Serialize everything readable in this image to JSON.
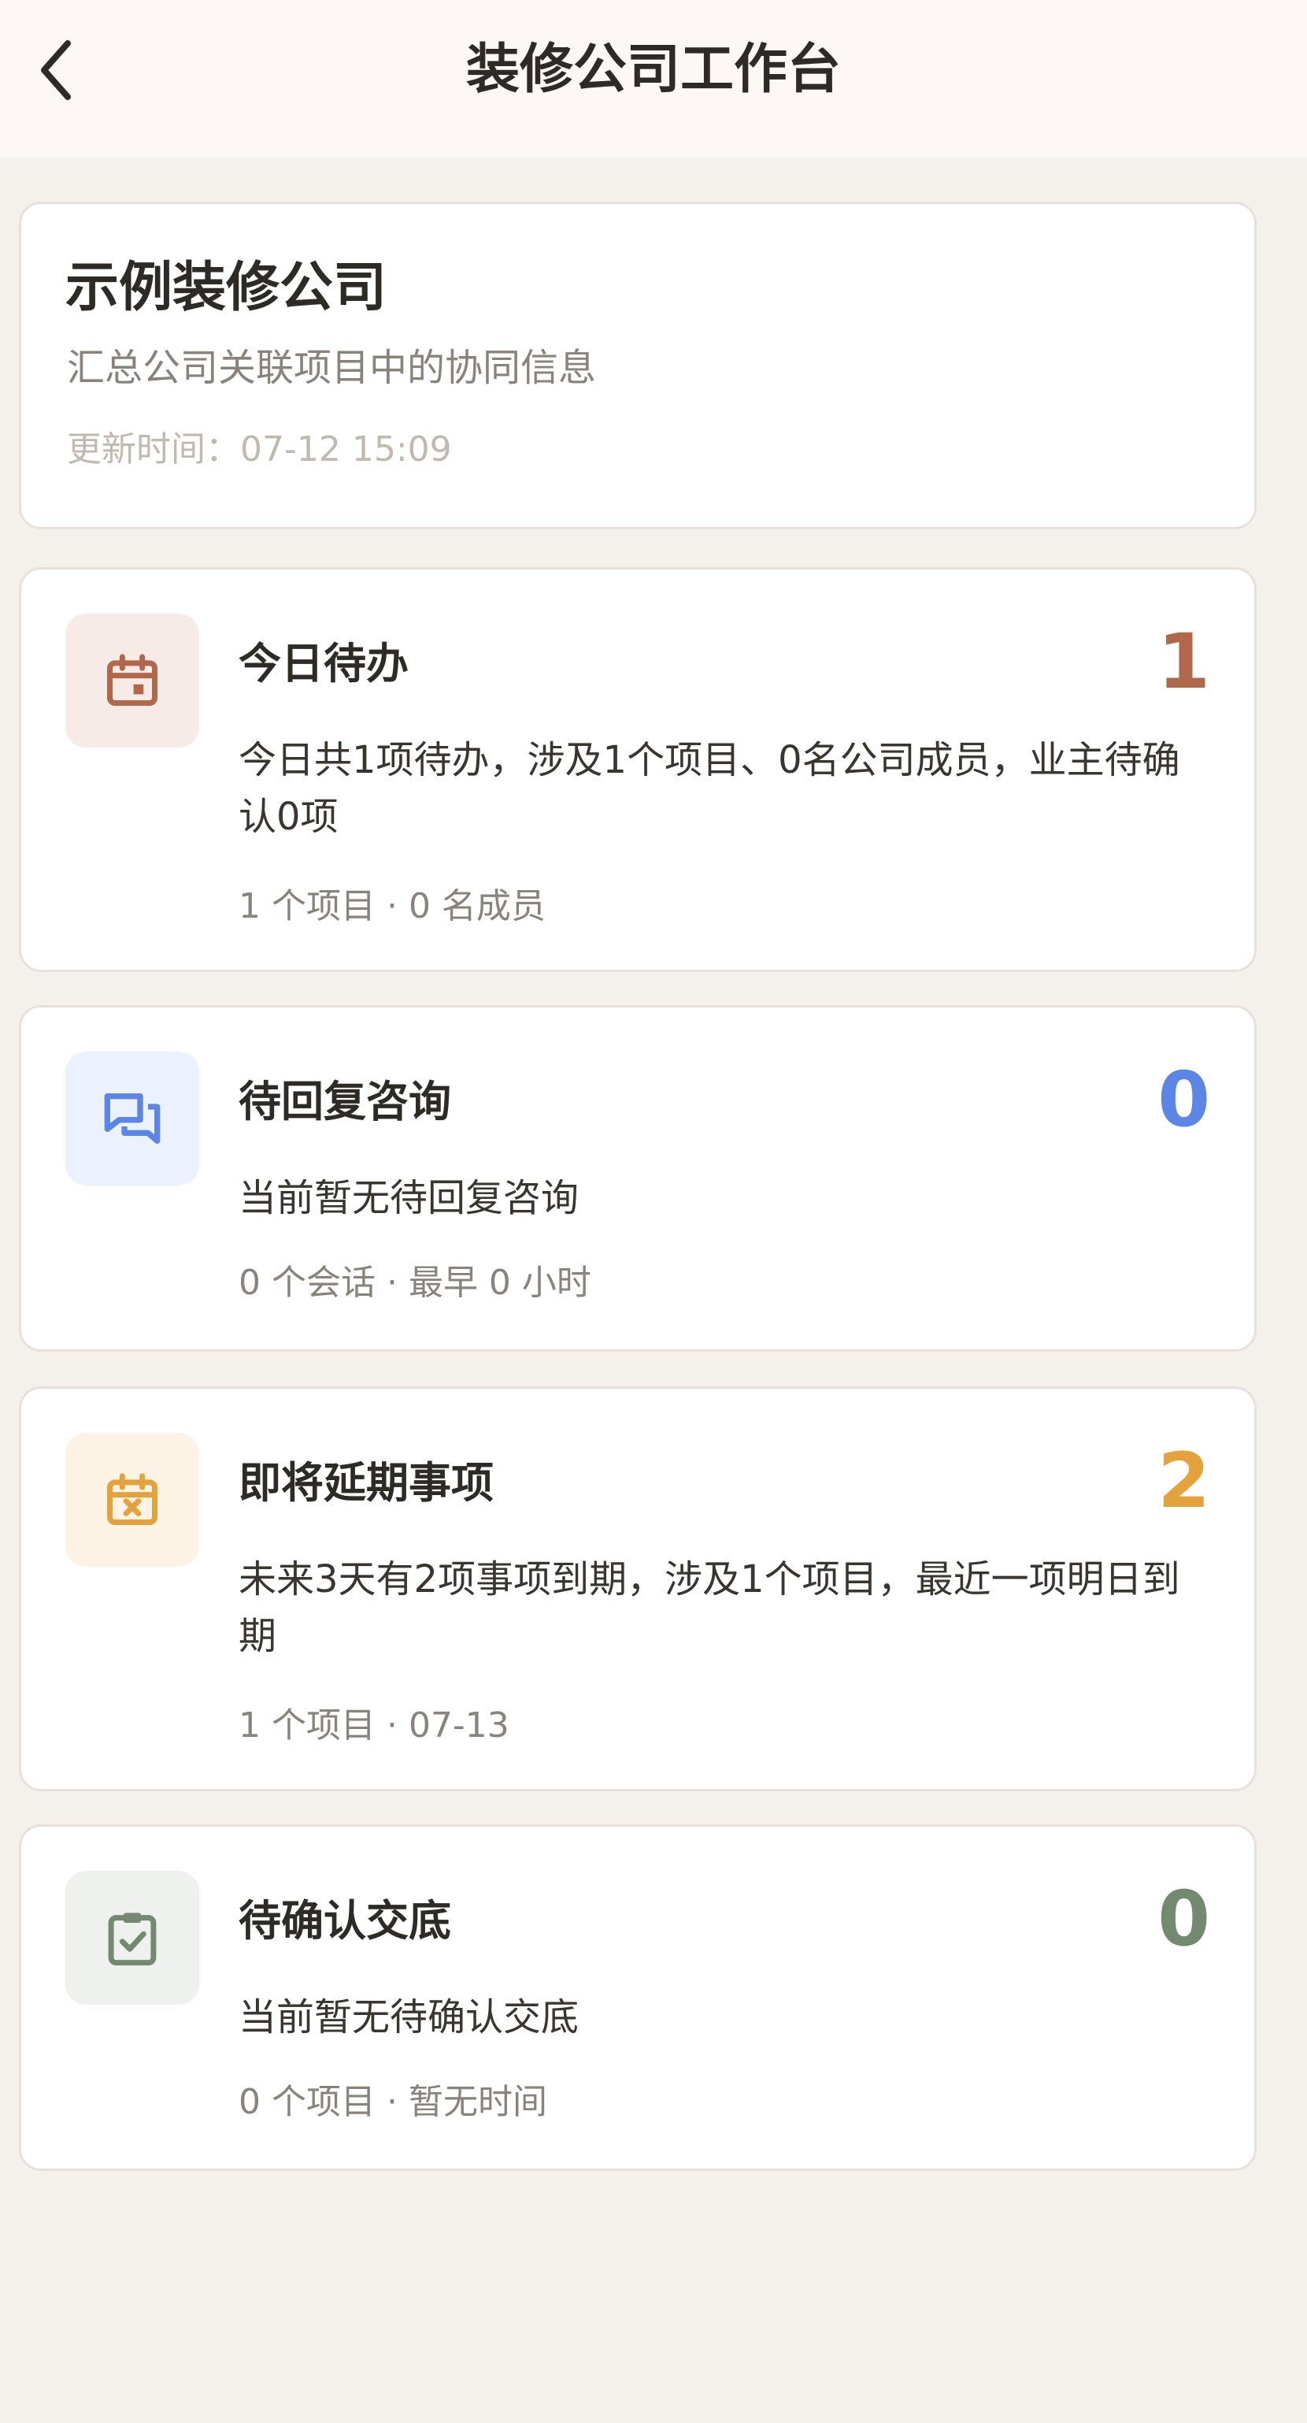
{
  "header": {
    "title": "装修公司工作台",
    "back_icon": "chevron-left-icon"
  },
  "company": {
    "name": "示例装修公司",
    "description": "汇总公司关联项目中的协同信息",
    "updated": "更新时间：07-12 15:09"
  },
  "tasks": [
    {
      "title": "今日待办",
      "count": "1",
      "description": "今日共1项待办，涉及1个项目、0名公司成员，业主待确认0项",
      "meta": "1 个项目 · 0 名成员",
      "icon": "calendar-icon",
      "accent": "#b0674a",
      "tile_bg": "#f6ebe7"
    },
    {
      "title": "待回复咨询",
      "count": "0",
      "description": "当前暂无待回复咨询",
      "meta": "0 个会话 · 最早 0 小时",
      "icon": "chat-bubbles-icon",
      "accent": "#5b86e5",
      "tile_bg": "#ebf1fd"
    },
    {
      "title": "即将延期事项",
      "count": "2",
      "description": "未来3天有2项事项到期，涉及1个项目，最近一项明日到期",
      "meta": "1 个项目 · 07-13",
      "icon": "calendar-x-icon",
      "accent": "#e3a23b",
      "tile_bg": "#fdf3e4"
    },
    {
      "title": "待确认交底",
      "count": "0",
      "description": "当前暂无待确认交底",
      "meta": "0 个项目 · 暂无时间",
      "icon": "clipboard-check-icon",
      "accent": "#728a6e",
      "tile_bg": "#eef1ee"
    }
  ]
}
